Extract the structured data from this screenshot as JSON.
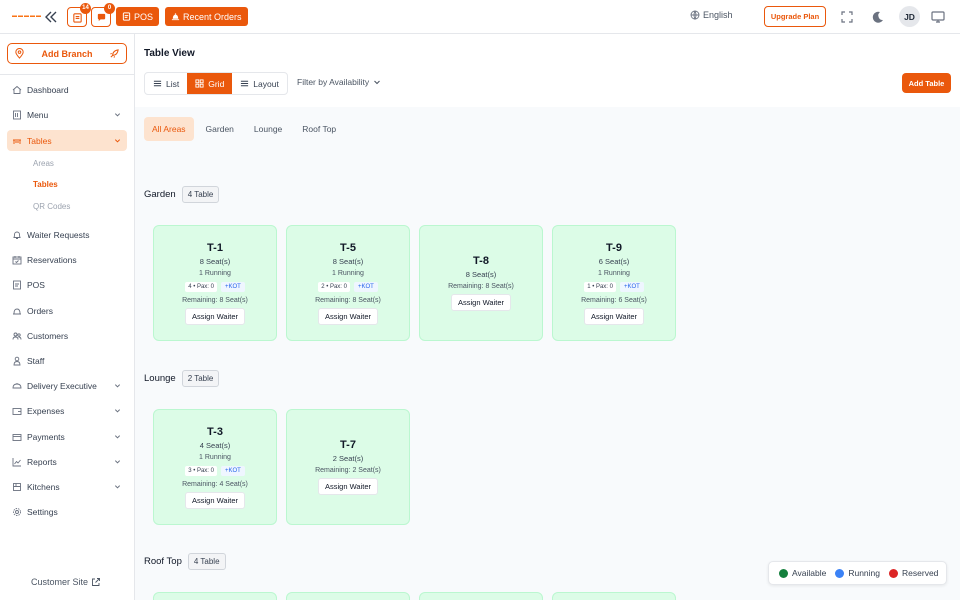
{
  "topbar": {
    "logo_text": "▬▬▬▬▬",
    "notif_badge": "14",
    "chat_badge": "0",
    "pos_label": "POS",
    "recent_orders_label": "Recent Orders",
    "language": "English",
    "upgrade_label": "Upgrade Plan",
    "avatar_initials": "JD"
  },
  "sidebar": {
    "add_branch_label": "Add Branch",
    "items": [
      {
        "label": "Dashboard"
      },
      {
        "label": "Menu"
      },
      {
        "label": "Tables"
      },
      {
        "label": "Waiter Requests"
      },
      {
        "label": "Reservations"
      },
      {
        "label": "POS"
      },
      {
        "label": "Orders"
      },
      {
        "label": "Customers"
      },
      {
        "label": "Staff"
      },
      {
        "label": "Delivery Executive"
      },
      {
        "label": "Expenses"
      },
      {
        "label": "Payments"
      },
      {
        "label": "Reports"
      },
      {
        "label": "Kitchens"
      },
      {
        "label": "Settings"
      }
    ],
    "tables_sub": [
      "Areas",
      "Tables",
      "QR Codes"
    ],
    "customer_site": "Customer Site"
  },
  "main": {
    "title": "Table View",
    "views": [
      "List",
      "Grid",
      "Layout"
    ],
    "filter_label": "Filter by Availability",
    "add_table_label": "Add Table",
    "tabs": [
      "All Areas",
      "Garden",
      "Lounge",
      "Roof Top"
    ],
    "sections": [
      {
        "name": "Garden",
        "count": "4 Table",
        "tables": [
          {
            "name": "T-1",
            "seats": "8 Seat(s)",
            "running": "1 Running",
            "pax": "4 • Pax: 0",
            "kot": "+KOT",
            "remaining": "Remaining: 8 Seat(s)",
            "assign": "Assign Waiter"
          },
          {
            "name": "T-5",
            "seats": "8 Seat(s)",
            "running": "1 Running",
            "pax": "2 • Pax: 0",
            "kot": "+KOT",
            "remaining": "Remaining: 8 Seat(s)",
            "assign": "Assign Waiter"
          },
          {
            "name": "T-8",
            "seats": "8 Seat(s)",
            "remaining": "Remaining: 8 Seat(s)",
            "assign": "Assign Waiter"
          },
          {
            "name": "T-9",
            "seats": "6 Seat(s)",
            "running": "1 Running",
            "pax": "1 • Pax: 0",
            "kot": "+KOT",
            "remaining": "Remaining: 6 Seat(s)",
            "assign": "Assign Waiter"
          }
        ]
      },
      {
        "name": "Lounge",
        "count": "2 Table",
        "tables": [
          {
            "name": "T-3",
            "seats": "4 Seat(s)",
            "running": "1 Running",
            "pax": "3 • Pax: 0",
            "kot": "+KOT",
            "remaining": "Remaining: 4 Seat(s)",
            "assign": "Assign Waiter"
          },
          {
            "name": "T-7",
            "seats": "2 Seat(s)",
            "remaining": "Remaining: 2 Seat(s)",
            "assign": "Assign Waiter"
          }
        ]
      },
      {
        "name": "Roof Top",
        "count": "4 Table",
        "tables": []
      }
    ],
    "legend": [
      {
        "label": "Available",
        "color": "#15803d"
      },
      {
        "label": "Running",
        "color": "#3b82f6"
      },
      {
        "label": "Reserved",
        "color": "#dc2626"
      }
    ]
  },
  "colors": {
    "accent": "#ea580c",
    "card_bg": "#dcfce7"
  }
}
